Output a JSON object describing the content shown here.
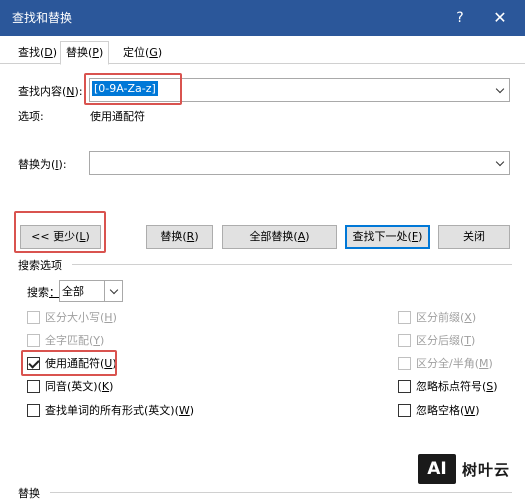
{
  "window": {
    "title": "查找和替换",
    "help_glyph": "?",
    "close_glyph": "✕"
  },
  "tabs": [
    {
      "label": "查找(D)",
      "text": "查找(",
      "key": "D",
      "end": ")"
    },
    {
      "label": "替换(P)",
      "text": "替换(",
      "key": "P",
      "end": ")",
      "active": true
    },
    {
      "label": "定位(G)",
      "text": "定位(",
      "key": "G",
      "end": ")"
    }
  ],
  "find": {
    "label_text": "查找内容(",
    "label_key": "N",
    "label_end": "):",
    "value": "[0-9A-Za-z]",
    "options_label": "选项:",
    "options_value": "使用通配符"
  },
  "replace": {
    "label_text": "替换为(",
    "label_key": "I",
    "label_end": "):",
    "value": ""
  },
  "buttons": {
    "less": {
      "text": "<< 更少(",
      "key": "L",
      "end": ")"
    },
    "replace": {
      "text": "替换(",
      "key": "R",
      "end": ")"
    },
    "replace_all": {
      "text": "全部替换(",
      "key": "A",
      "end": ")"
    },
    "find_next": {
      "text": "查找下一处(",
      "key": "F",
      "end": ")"
    },
    "close": "关闭"
  },
  "search_options": {
    "section_label": "搜索选项",
    "search_label_text": "搜索",
    "search_label_key": "：",
    "search_value": "全部"
  },
  "left_options": [
    {
      "text": "区分大小写(",
      "key": "H",
      "end": ")",
      "checked": false,
      "disabled": true
    },
    {
      "text": "全字匹配(",
      "key": "Y",
      "end": ")",
      "checked": false,
      "disabled": true
    },
    {
      "text": "使用通配符(",
      "key": "U",
      "end": ")",
      "checked": true,
      "disabled": false
    },
    {
      "text": "同音(英文)(",
      "key": "K",
      "end": ")",
      "checked": false,
      "disabled": false
    },
    {
      "text": "查找单词的所有形式(英文)(",
      "key": "W",
      "end": ")",
      "checked": false,
      "disabled": false
    }
  ],
  "right_options": [
    {
      "text": "区分前缀(",
      "key": "X",
      "end": ")",
      "checked": false,
      "disabled": true
    },
    {
      "text": "区分后缀(",
      "key": "T",
      "end": ")",
      "checked": false,
      "disabled": true
    },
    {
      "text": "区分全/半角(",
      "key": "M",
      "end": ")",
      "checked": false,
      "disabled": true
    },
    {
      "text": "忽略标点符号(",
      "key": "S",
      "end": ")",
      "checked": false,
      "disabled": false
    },
    {
      "text": "忽略空格(",
      "key": "W",
      "end": ")",
      "checked": false,
      "disabled": false
    }
  ],
  "bottom_section_label": "替换",
  "watermark": {
    "logo": "AI",
    "text": "树叶云"
  }
}
